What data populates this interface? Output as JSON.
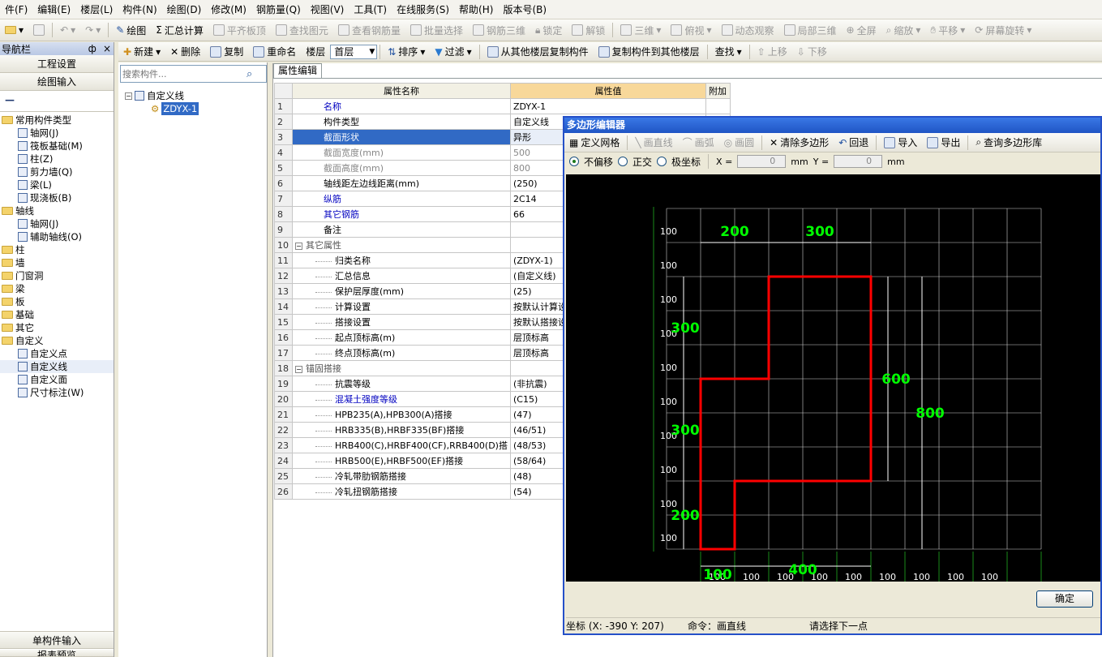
{
  "menu": [
    "件(F)",
    "编辑(E)",
    "楼层(L)",
    "构件(N)",
    "绘图(D)",
    "修改(M)",
    "钢筋量(Q)",
    "视图(V)",
    "工具(T)",
    "在线服务(S)",
    "帮助(H)",
    "版本号(B)"
  ],
  "toolbar1": {
    "draw": "绘图",
    "sum": "汇总计算",
    "level_board": "平齐板顶",
    "find_elem": "查找图元",
    "view_rebar": "查看钢筋量",
    "batch": "批量选择",
    "rebar3d": "钢筋三维",
    "lock": "锁定",
    "unlock": "解锁",
    "three_d": "三维",
    "top_view": "俯视",
    "dynamic": "动态观察",
    "local3d": "局部三维",
    "fullscreen": "全屏",
    "zoom": "缩放",
    "pan": "平移",
    "rotate": "屏幕旋转"
  },
  "nav": {
    "title": "导航栏",
    "pin": "ф",
    "close": "×",
    "project_settings": "工程设置",
    "draw_input": "绘图输入",
    "collapse": "—",
    "single_input": "单构件输入",
    "report_preview": "报表预览",
    "tree": [
      {
        "label": "常用构件类型",
        "level": 0,
        "type": "folder"
      },
      {
        "label": "轴网(J)",
        "level": 1,
        "type": "item"
      },
      {
        "label": "筏板基础(M)",
        "level": 1,
        "type": "item"
      },
      {
        "label": "柱(Z)",
        "level": 1,
        "type": "item"
      },
      {
        "label": "剪力墙(Q)",
        "level": 1,
        "type": "item"
      },
      {
        "label": "梁(L)",
        "level": 1,
        "type": "item"
      },
      {
        "label": "现浇板(B)",
        "level": 1,
        "type": "item"
      },
      {
        "label": "轴线",
        "level": 0,
        "type": "folder"
      },
      {
        "label": "轴网(J)",
        "level": 1,
        "type": "item"
      },
      {
        "label": "辅助轴线(O)",
        "level": 1,
        "type": "item"
      },
      {
        "label": "柱",
        "level": 0,
        "type": "folder"
      },
      {
        "label": "墙",
        "level": 0,
        "type": "folder"
      },
      {
        "label": "门窗洞",
        "level": 0,
        "type": "folder"
      },
      {
        "label": "梁",
        "level": 0,
        "type": "folder"
      },
      {
        "label": "板",
        "level": 0,
        "type": "folder"
      },
      {
        "label": "基础",
        "level": 0,
        "type": "folder"
      },
      {
        "label": "其它",
        "level": 0,
        "type": "folder"
      },
      {
        "label": "自定义",
        "level": 0,
        "type": "folder"
      },
      {
        "label": "自定义点",
        "level": 1,
        "type": "item"
      },
      {
        "label": "自定义线",
        "level": 1,
        "type": "item"
      },
      {
        "label": "自定义面",
        "level": 1,
        "type": "item"
      },
      {
        "label": "尺寸标注(W)",
        "level": 1,
        "type": "item"
      }
    ]
  },
  "toolbar2": {
    "new": "新建",
    "delete": "删除",
    "copy": "复制",
    "rename": "重命名",
    "floor_label": "楼层",
    "floor_value": "首层",
    "sort": "排序",
    "filter": "过滤",
    "copy_from": "从其他楼层复制构件",
    "copy_to": "复制构件到其他楼层",
    "find": "查找",
    "up": "上移",
    "down": "下移"
  },
  "component_list": {
    "search_placeholder": "搜索构件...",
    "root": "自定义线",
    "child": "ZDYX-1"
  },
  "property_tab": "属性编辑",
  "property_headers": {
    "name": "属性名称",
    "value": "属性值",
    "extra": "附加"
  },
  "properties": [
    {
      "n": "1",
      "name": "名称",
      "value": "ZDYX-1",
      "style": "blue"
    },
    {
      "n": "2",
      "name": "构件类型",
      "value": "自定义线",
      "style": "normal"
    },
    {
      "n": "3",
      "name": "截面形状",
      "value": "异形",
      "style": "selected"
    },
    {
      "n": "4",
      "name": "截面宽度(mm)",
      "value": "500",
      "style": "gray"
    },
    {
      "n": "5",
      "name": "截面高度(mm)",
      "value": "800",
      "style": "gray"
    },
    {
      "n": "6",
      "name": "轴线距左边线距离(mm)",
      "value": "(250)",
      "style": "normal"
    },
    {
      "n": "7",
      "name": "纵筋",
      "value": "2C14",
      "style": "blue"
    },
    {
      "n": "8",
      "name": "其它钢筋",
      "value": "66",
      "style": "blue"
    },
    {
      "n": "9",
      "name": "备注",
      "value": "",
      "style": "normal"
    },
    {
      "n": "10",
      "name": "其它属性",
      "value": "",
      "style": "group"
    },
    {
      "n": "11",
      "name": "归类名称",
      "value": "(ZDYX-1)",
      "style": "child"
    },
    {
      "n": "12",
      "name": "汇总信息",
      "value": "(自定义线)",
      "style": "child"
    },
    {
      "n": "13",
      "name": "保护层厚度(mm)",
      "value": "(25)",
      "style": "child"
    },
    {
      "n": "14",
      "name": "计算设置",
      "value": "按默认计算设置计",
      "style": "child"
    },
    {
      "n": "15",
      "name": "搭接设置",
      "value": "按默认搭接设置计",
      "style": "child"
    },
    {
      "n": "16",
      "name": "起点顶标高(m)",
      "value": "层顶标高",
      "style": "child"
    },
    {
      "n": "17",
      "name": "终点顶标高(m)",
      "value": "层顶标高",
      "style": "child"
    },
    {
      "n": "18",
      "name": "锚固搭接",
      "value": "",
      "style": "group"
    },
    {
      "n": "19",
      "name": "抗震等级",
      "value": "(非抗震)",
      "style": "child"
    },
    {
      "n": "20",
      "name": "混凝土强度等级",
      "value": "(C15)",
      "style": "childblue"
    },
    {
      "n": "21",
      "name": "HPB235(A),HPB300(A)搭接",
      "value": "(47)",
      "style": "child"
    },
    {
      "n": "22",
      "name": "HRB335(B),HRBF335(BF)搭接",
      "value": "(46/51)",
      "style": "child"
    },
    {
      "n": "23",
      "name": "HRB400(C),HRBF400(CF),RRB400(D)搭",
      "value": "(48/53)",
      "style": "child"
    },
    {
      "n": "24",
      "name": "HRB500(E),HRBF500(EF)搭接",
      "value": "(58/64)",
      "style": "child"
    },
    {
      "n": "25",
      "name": "冷轧带肋钢筋搭接",
      "value": "(48)",
      "style": "child"
    },
    {
      "n": "26",
      "name": "冷轧扭钢筋搭接",
      "value": "(54)",
      "style": "child"
    }
  ],
  "polygon_editor": {
    "title": "多边形编辑器",
    "tools": {
      "grid": "定义网格",
      "line": "画直线",
      "arc": "画弧",
      "circle": "画圆",
      "clear": "清除多边形",
      "undo": "回退",
      "import": "导入",
      "export": "导出",
      "query": "查询多边形库"
    },
    "options": {
      "no_offset": "不偏移",
      "ortho": "正交",
      "polar": "极坐标",
      "x_label": "X =",
      "x_value": "0",
      "y_label": "Y =",
      "y_value": "0",
      "unit": "mm"
    },
    "grid_labels": {
      "row": "100",
      "col": "100"
    },
    "dims": {
      "top1": "200",
      "top2": "300",
      "left1": "300",
      "left2": "300",
      "left3": "200",
      "right1": "600",
      "right2": "800",
      "bottom1": "100",
      "bottom2": "400"
    },
    "ok": "确定",
    "status": {
      "coord": "坐标 (X: -390 Y: 207)",
      "cmd": "命令：画直线",
      "prompt": "请选择下一点"
    },
    "colors": {
      "shape": "#ff0000",
      "dim": "#00ff00",
      "grid": "#d0d0d0"
    }
  }
}
